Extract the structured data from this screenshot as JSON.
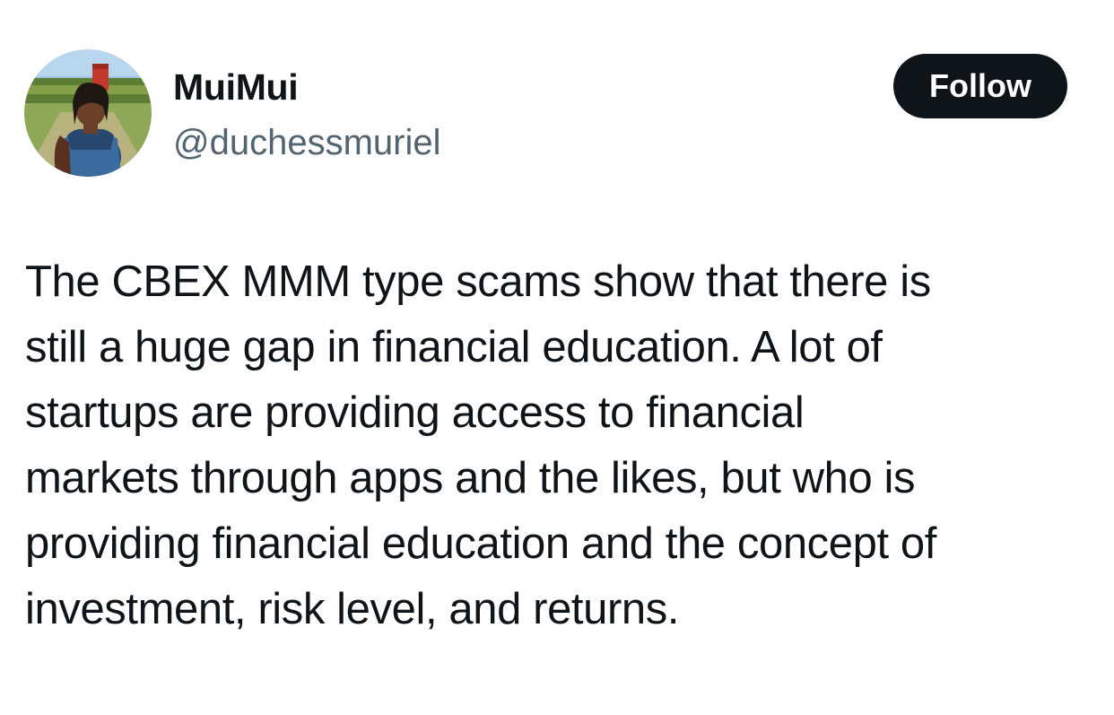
{
  "author": {
    "name": "MuiMui",
    "handle": "@duchessmuriel"
  },
  "follow_button": {
    "label": "Follow"
  },
  "tweet": {
    "lines": [
      "The CBEX MMM type scams show that there is",
      "still a huge gap in financial education. A lot of",
      "startups are providing access to financial",
      "markets through apps and the likes, but who is",
      "providing financial education and the concept of",
      "investment, risk level, and returns."
    ]
  },
  "colors": {
    "text_primary": "#0f1419",
    "text_secondary": "#536471",
    "button_bg": "#0f1419",
    "button_text": "#ffffff",
    "background": "#ffffff"
  }
}
